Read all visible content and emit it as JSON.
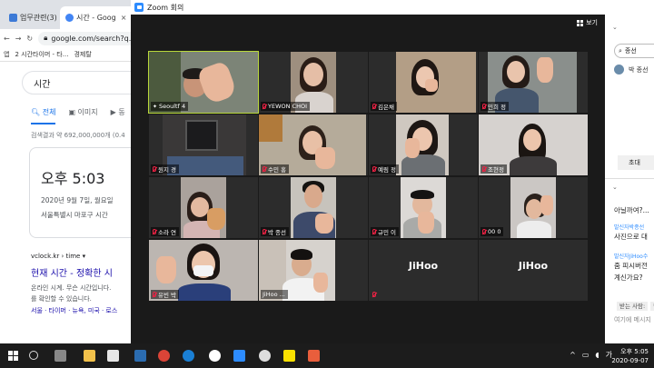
{
  "browser": {
    "tabs": [
      {
        "label": "업무관련(3)",
        "favicon_color": "#3d7ad6"
      },
      {
        "label": "시간 - Goog",
        "favicon_color": "#4285f4"
      }
    ],
    "address": "google.com/search?q...",
    "bookmarks": [
      "앱",
      "2 시간타이머 - 타...",
      "경제탈"
    ],
    "search_query": "시간",
    "search_tabs": [
      "전체",
      "이미지",
      "동"
    ],
    "result_count": "검색결과 약 692,000,000개 (0.4",
    "time_card": {
      "time": "오후 5:03",
      "date": "2020년 9월 7일, 월요일",
      "zone": "서울특별시 마포구 시간"
    },
    "result": {
      "url": "vclock.kr › time ▾",
      "title": "현재 시간 - 정확한 시",
      "snippet_1": "온라인 시계. 무슨 시간입니다.",
      "snippet_2": "를 확인할 수 있습니다.",
      "links": "서울 · 타이머 · 뉴욕, 미국 · 로스"
    }
  },
  "zoom": {
    "window_title": "Zoom 회의",
    "view_button": "보기",
    "participants": [
      {
        "name": "Seoultf 4",
        "muted": false,
        "pinned": true,
        "active": true,
        "video": true
      },
      {
        "name": "YEWON CHOI",
        "muted": true,
        "video": true
      },
      {
        "name": "김은채",
        "muted": true,
        "video": true
      },
      {
        "name": "민희 정",
        "muted": true,
        "video": true
      },
      {
        "name": "원지 경",
        "muted": true,
        "video": true
      },
      {
        "name": "수민 홍",
        "muted": true,
        "video": true
      },
      {
        "name": "예림 정",
        "muted": true,
        "video": true
      },
      {
        "name": "조현정",
        "muted": true,
        "video": true
      },
      {
        "name": "소라 연",
        "muted": true,
        "video": true
      },
      {
        "name": "박 종선",
        "muted": true,
        "video": true
      },
      {
        "name": "규민 이",
        "muted": true,
        "video": true
      },
      {
        "name": "00 0",
        "muted": true,
        "video": true
      },
      {
        "name": "유빈 박",
        "muted": true,
        "video": true
      },
      {
        "name": "JiHoo ...",
        "muted": false,
        "video": true
      },
      {
        "name": "JiHoo",
        "muted": true,
        "video": false
      },
      {
        "name": "JiHoo",
        "muted": false,
        "video": false
      }
    ]
  },
  "chat_panel": {
    "search_value": "종선",
    "first_user": "박 종선",
    "invite_button": "초대",
    "messages": [
      {
        "from": "",
        "text": "아닐까여?..."
      },
      {
        "from": "발신자박종선",
        "text": "사진으로 대"
      },
      {
        "from": "발신자JiHoo수",
        "text": "줌 피시버전",
        "text2": "계신가요?"
      }
    ],
    "to_label": "받는 사람:",
    "to_value": "박",
    "input_placeholder": "여기에 메시지"
  },
  "taskbar": {
    "tray_lang": "가",
    "clock_time": "오후 5:05",
    "clock_date": "2020-09-07"
  },
  "colors": {
    "active_speaker": "#b9d83b",
    "muted_mic": "#ee2244",
    "zoom_blue": "#2d8cff",
    "link_blue": "#1a0dab"
  }
}
